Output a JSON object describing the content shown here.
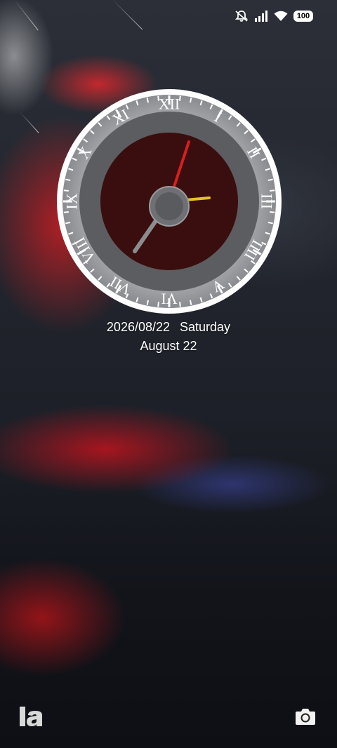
{
  "status_bar": {
    "battery_level": "100",
    "icons": [
      "mute-icon",
      "signal-icon",
      "wifi-icon",
      "battery-icon"
    ]
  },
  "clock": {
    "numerals": [
      "XII",
      "I",
      "II",
      "III",
      "IIII",
      "V",
      "VI",
      "VII",
      "VIII",
      "IX",
      "X",
      "XI"
    ],
    "dial_color": "#3a0e0e",
    "hour_hand_color": "#e6c229",
    "second_hand_color": "#d42020"
  },
  "lock_screen": {
    "date_numeric": "2026/08/22",
    "weekday": "Saturday",
    "date_long": "August 22"
  },
  "bottom_bar": {
    "left_shortcut": "la",
    "right_shortcut": "camera-icon"
  }
}
